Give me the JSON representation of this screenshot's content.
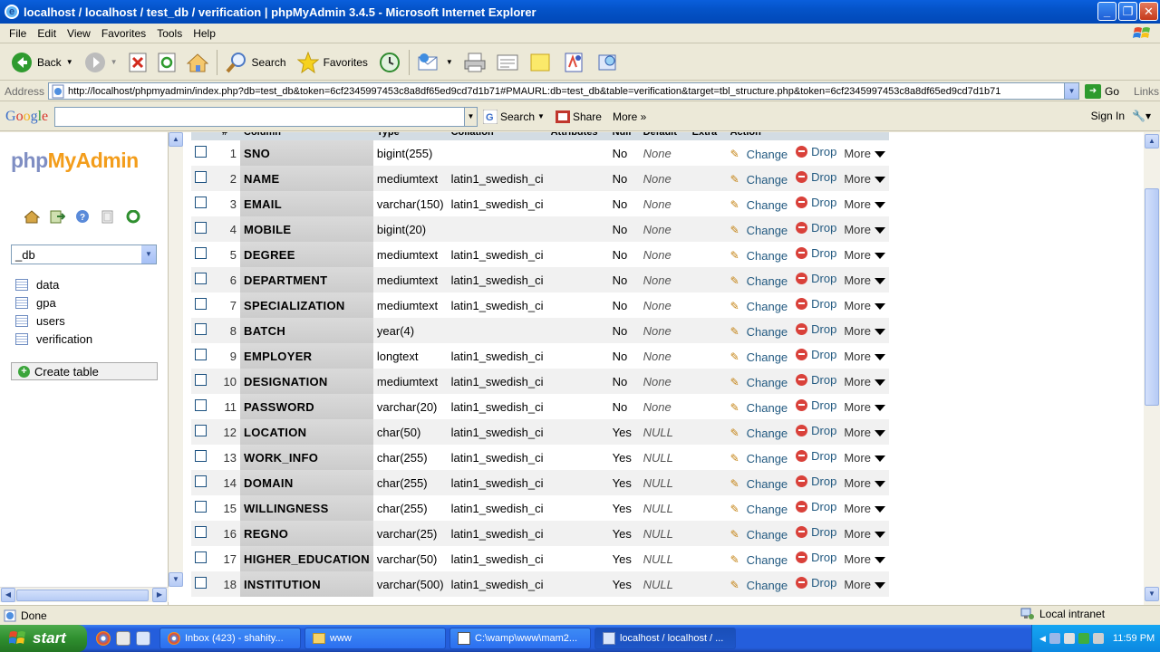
{
  "window": {
    "title": "localhost / localhost / test_db / verification | phpMyAdmin 3.4.5 - Microsoft Internet Explorer",
    "buttons": [
      "_",
      "❐",
      "✕"
    ]
  },
  "menu": [
    "File",
    "Edit",
    "View",
    "Favorites",
    "Tools",
    "Help"
  ],
  "toolbar": {
    "back": "Back",
    "search": "Search",
    "favorites": "Favorites"
  },
  "address": {
    "label": "Address",
    "url": "http://localhost/phpmyadmin/index.php?db=test_db&token=6cf2345997453c8a8df65ed9cd7d1b71#PMAURL:db=test_db&table=verification&target=tbl_structure.php&token=6cf2345997453c8a8df65ed9cd7d1b71",
    "go": "Go",
    "links": "Links"
  },
  "google": {
    "logo": "Google",
    "search": "Search",
    "share": "Share",
    "more": "More »",
    "signin": "Sign In"
  },
  "sidebar": {
    "logo_php": "php",
    "logo_my": "MyAdmin",
    "db_selected": "_db",
    "tables": [
      "data",
      "gpa",
      "users",
      "verification"
    ],
    "create_table": "Create table"
  },
  "structure": {
    "headers": [
      "#",
      "Column",
      "Type",
      "Collation",
      "Attributes",
      "Null",
      "Default",
      "Extra",
      "Action"
    ],
    "rows": [
      {
        "n": "1",
        "name": "SNO",
        "type": "bigint(255)",
        "collation": "",
        "null": "No",
        "default": "None"
      },
      {
        "n": "2",
        "name": "NAME",
        "type": "mediumtext",
        "collation": "latin1_swedish_ci",
        "null": "No",
        "default": "None"
      },
      {
        "n": "3",
        "name": "EMAIL",
        "type": "varchar(150)",
        "collation": "latin1_swedish_ci",
        "null": "No",
        "default": "None"
      },
      {
        "n": "4",
        "name": "MOBILE",
        "type": "bigint(20)",
        "collation": "",
        "null": "No",
        "default": "None"
      },
      {
        "n": "5",
        "name": "DEGREE",
        "type": "mediumtext",
        "collation": "latin1_swedish_ci",
        "null": "No",
        "default": "None"
      },
      {
        "n": "6",
        "name": "DEPARTMENT",
        "type": "mediumtext",
        "collation": "latin1_swedish_ci",
        "null": "No",
        "default": "None"
      },
      {
        "n": "7",
        "name": "SPECIALIZATION",
        "type": "mediumtext",
        "collation": "latin1_swedish_ci",
        "null": "No",
        "default": "None"
      },
      {
        "n": "8",
        "name": "BATCH",
        "type": "year(4)",
        "collation": "",
        "null": "No",
        "default": "None"
      },
      {
        "n": "9",
        "name": "EMPLOYER",
        "type": "longtext",
        "collation": "latin1_swedish_ci",
        "null": "No",
        "default": "None"
      },
      {
        "n": "10",
        "name": "DESIGNATION",
        "type": "mediumtext",
        "collation": "latin1_swedish_ci",
        "null": "No",
        "default": "None"
      },
      {
        "n": "11",
        "name": "PASSWORD",
        "type": "varchar(20)",
        "collation": "latin1_swedish_ci",
        "null": "No",
        "default": "None"
      },
      {
        "n": "12",
        "name": "LOCATION",
        "type": "char(50)",
        "collation": "latin1_swedish_ci",
        "null": "Yes",
        "default": "NULL"
      },
      {
        "n": "13",
        "name": "WORK_INFO",
        "type": "char(255)",
        "collation": "latin1_swedish_ci",
        "null": "Yes",
        "default": "NULL"
      },
      {
        "n": "14",
        "name": "DOMAIN",
        "type": "char(255)",
        "collation": "latin1_swedish_ci",
        "null": "Yes",
        "default": "NULL"
      },
      {
        "n": "15",
        "name": "WILLINGNESS",
        "type": "char(255)",
        "collation": "latin1_swedish_ci",
        "null": "Yes",
        "default": "NULL"
      },
      {
        "n": "16",
        "name": "REGNO",
        "type": "varchar(25)",
        "collation": "latin1_swedish_ci",
        "null": "Yes",
        "default": "NULL"
      },
      {
        "n": "17",
        "name": "HIGHER_EDUCATION",
        "type": "varchar(50)",
        "collation": "latin1_swedish_ci",
        "null": "Yes",
        "default": "NULL"
      },
      {
        "n": "18",
        "name": "INSTITUTION",
        "type": "varchar(500)",
        "collation": "latin1_swedish_ci",
        "null": "Yes",
        "default": "NULL"
      }
    ],
    "actions": {
      "change": "Change",
      "drop": "Drop",
      "more": "More"
    }
  },
  "status": {
    "left": "Done",
    "zone": "Local intranet"
  },
  "taskbar": {
    "start": "start",
    "tasks": [
      {
        "label": "Inbox (423) - shahity...",
        "active": false
      },
      {
        "label": "www",
        "active": false
      },
      {
        "label": "C:\\wamp\\www\\mam2...",
        "active": false
      },
      {
        "label": "localhost / localhost / ...",
        "active": true
      }
    ],
    "clock": "11:59 PM"
  },
  "colors": {
    "titlebar": "#0453c8",
    "pma_php": "#7f8ec3",
    "pma_myadmin": "#f39d1b",
    "action_link": "#235a81",
    "drop_icon": "#d9413a",
    "taskbar": "#245edc",
    "start_button": "#2f8f2f"
  }
}
